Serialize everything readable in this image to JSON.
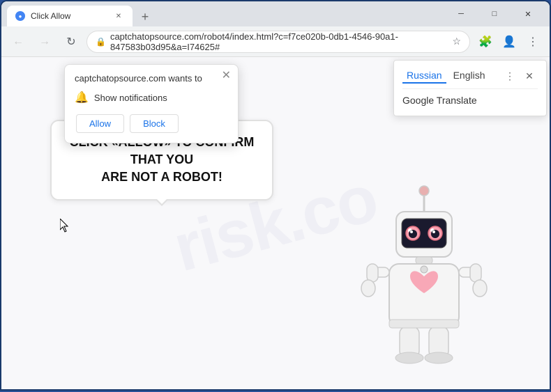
{
  "browser": {
    "tab": {
      "title": "Click Allow",
      "favicon": "●"
    },
    "new_tab_label": "+",
    "window_controls": {
      "minimize": "─",
      "maximize": "□",
      "close": "✕"
    },
    "toolbar": {
      "back": "←",
      "forward": "→",
      "refresh": "↻",
      "url": "captchatopsource.com/robot4/index.html?c=f7ce020b-0db1-4546-90a1-847583b03d95&a=I74625#",
      "bookmark": "☆",
      "extension": "🧩",
      "profile": "👤",
      "menu": "⋮"
    }
  },
  "notification_popup": {
    "title": "captchatopsource.com wants to",
    "item_icon": "🔔",
    "item_text": "Show notifications",
    "allow_label": "Allow",
    "block_label": "Block",
    "close_label": "✕"
  },
  "translate_panel": {
    "tab_russian": "Russian",
    "tab_english": "English",
    "service": "Google Translate",
    "menu_icon": "⋮",
    "close_icon": "✕"
  },
  "page": {
    "bubble_text_line1": "CLICK «ALLOW» TO CONFIRM THAT YOU",
    "bubble_text_line2": "ARE NOT A ROBOT!",
    "watermark": "risk.co"
  }
}
